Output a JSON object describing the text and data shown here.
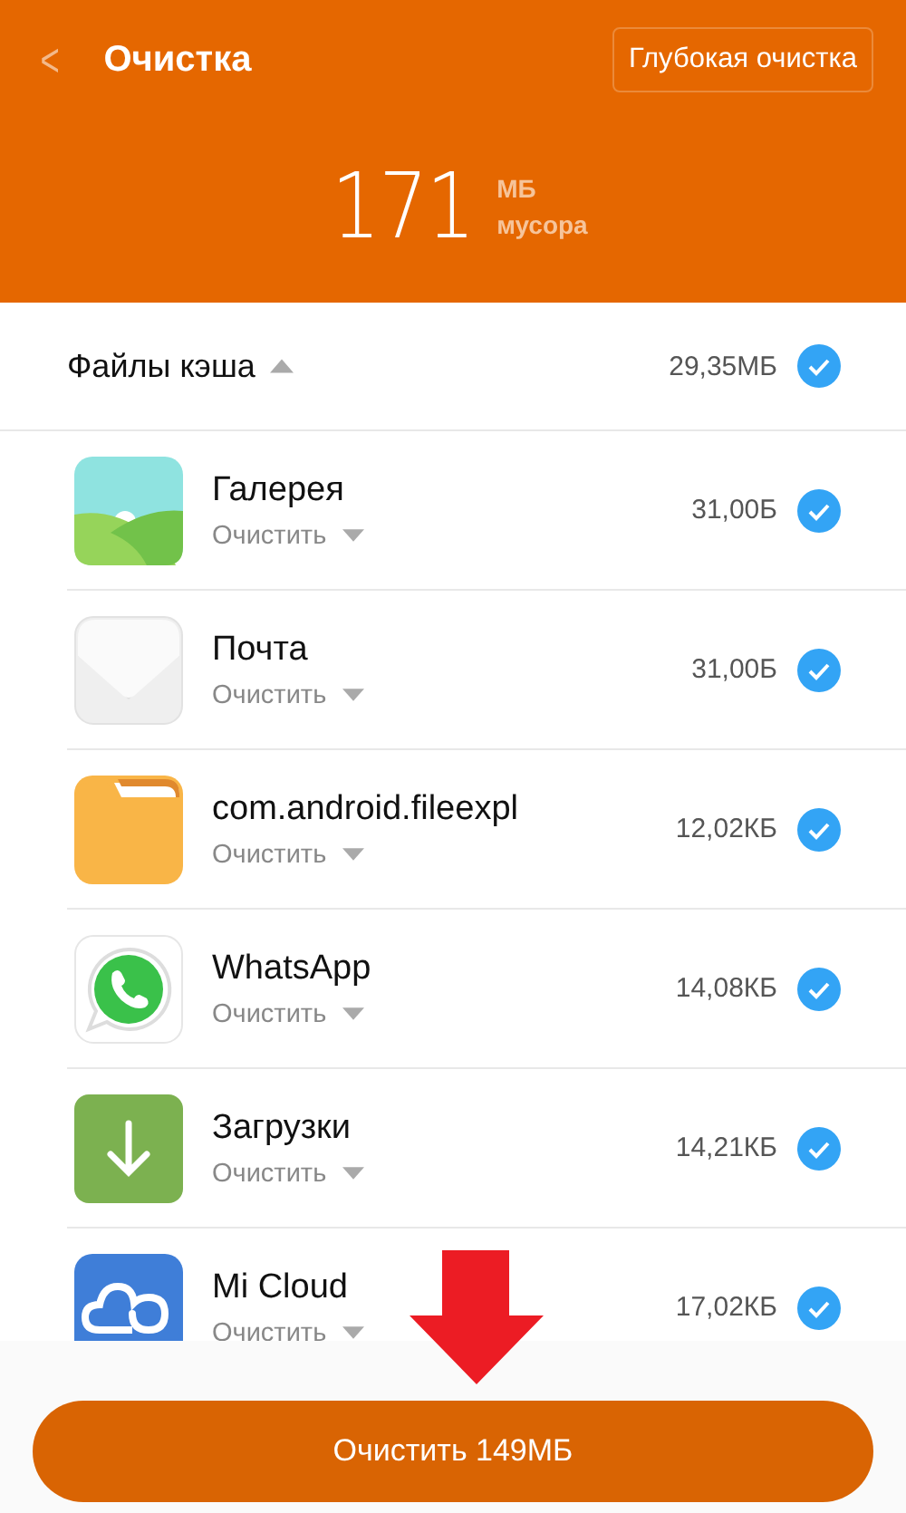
{
  "header": {
    "back": "<",
    "title": "Очистка",
    "deep_clean_button": "Глубокая очистка",
    "total": "171",
    "unit": "МБ",
    "unit_caption": "мусора"
  },
  "section": {
    "title": "Файлы кэша",
    "expanded": true,
    "size": "29,35МБ",
    "checked": true
  },
  "apps": [
    {
      "kind": "gallery",
      "name": "Галерея",
      "action": "Очистить",
      "size": "31,00Б",
      "checked": true
    },
    {
      "kind": "mail",
      "name": "Почта",
      "action": "Очистить",
      "size": "31,00Б",
      "checked": true
    },
    {
      "kind": "folder",
      "name": "com.android.fileexpl",
      "action": "Очистить",
      "size": "12,02КБ",
      "checked": true
    },
    {
      "kind": "chat",
      "name": "WhatsApp",
      "action": "Очистить",
      "size": "14,08КБ",
      "checked": true
    },
    {
      "kind": "download",
      "name": "Загрузки",
      "action": "Очистить",
      "size": "14,21КБ",
      "checked": true
    },
    {
      "kind": "cloud",
      "name": "Mi Cloud",
      "action": "Очистить",
      "size": "17,02КБ",
      "checked": true
    }
  ],
  "clean_button": "Очистить 149МБ"
}
